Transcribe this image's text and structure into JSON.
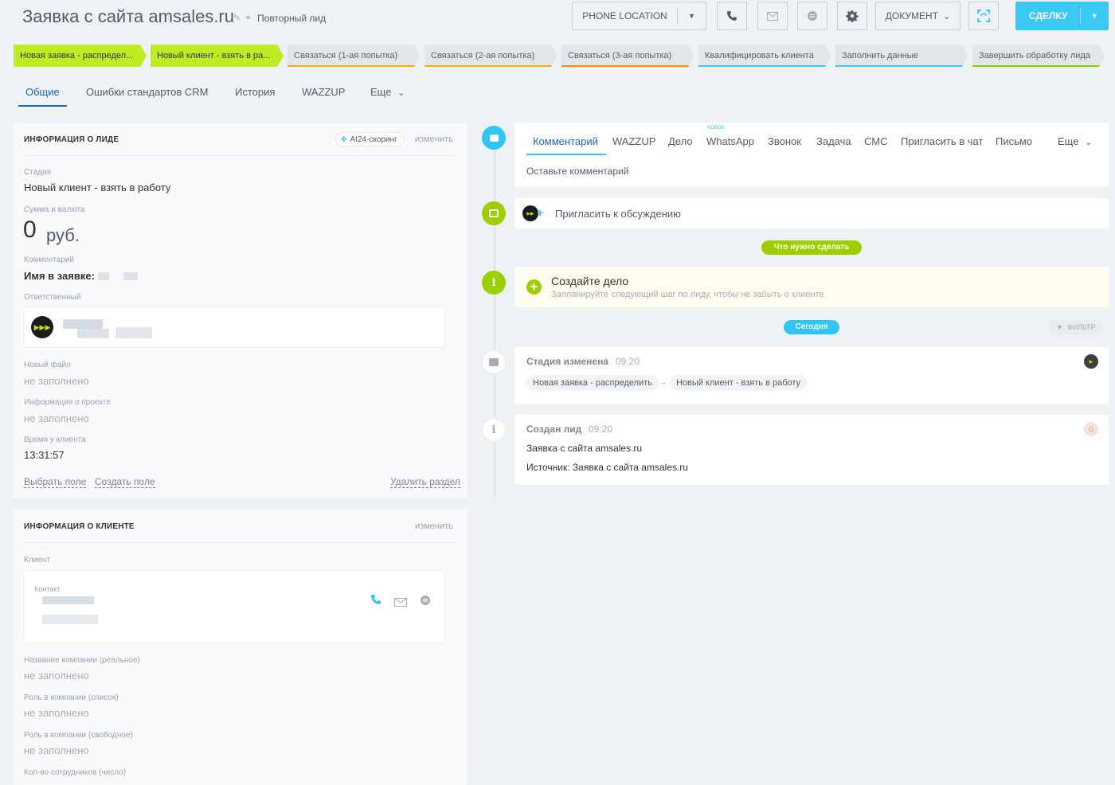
{
  "header": {
    "title": "Заявка с сайта amsales.ru",
    "repeat_label": "Повторный лид",
    "phone_location": "PHONE LOCATION",
    "document": "ДОКУМЕНТ",
    "deal": "СДЕЛКУ"
  },
  "stages": [
    "Новая заявка - распредел...",
    "Новый клиент - взять в ра...",
    "Связаться (1-ая попытка)",
    "Связаться (2-ая попытка)",
    "Связаться (3-ая попытка)",
    "Квалифицировать клиента",
    "Заполнить данные",
    "Завершить обработку лида"
  ],
  "tabs": [
    "Общие",
    "Ошибки стандартов CRM",
    "История",
    "WAZZUP",
    "Еще"
  ],
  "lead_info": {
    "title": "ИНФОРМАЦИЯ О ЛИДЕ",
    "ai_scoring": "AI24-скоринг",
    "edit": "изменить",
    "stage_label": "Стадия",
    "stage_value": "Новый клиент - взять в работу",
    "sum_label": "Сумма и валюта",
    "sum_value": "0",
    "currency": "руб.",
    "comment_label": "Комментарий",
    "comment_value": "Имя в заявке:",
    "responsible_label": "Ответственный",
    "new_file_label": "Новый файл",
    "new_file_value": "не заполнено",
    "project_label": "Информация о проекте",
    "project_value": "не заполнено",
    "client_time_label": "Время у клиента",
    "client_time_value": "13:31:57",
    "choose_field": "Выбрать поле",
    "create_field": "Создать поле",
    "delete_section": "Удалить раздел"
  },
  "client_info": {
    "title": "ИНФОРМАЦИЯ О КЛИЕНТЕ",
    "edit": "изменить",
    "client_label": "Клиент",
    "contact_label": "Контакт",
    "company_label": "Название компании (реальное)",
    "company_value": "не заполнено",
    "role_list_label": "Роль в компании (список)",
    "role_list_value": "не заполнено",
    "role_free_label": "Роль в компании (свободное)",
    "role_free_value": "не заполнено",
    "employees_label": "Кол-во сотрудников (число)"
  },
  "editor": {
    "tabs": [
      "Комментарий",
      "WAZZUP",
      "Дело",
      "WhatsApp",
      "Звонок",
      "Задача",
      "СМС",
      "Пригласить в чат",
      "Письмо",
      "Еще"
    ],
    "new_badge": "НОВОЕ",
    "placeholder": "Оставьте комментарий"
  },
  "timeline": {
    "invite": "Пригласить к обсуждению",
    "todo_pill": "Что нужно сделать",
    "create_task_title": "Создайте дело",
    "create_task_hint": "Запланируйте следующий шаг по лиду, чтобы не забыть о клиенте",
    "today_pill": "Сегодня",
    "filter": "ФИЛЬТР",
    "stage_changed": "Стадия изменена",
    "stage_changed_time": "09:20",
    "stage_from": "Новая заявка - распределить",
    "stage_to": "Новый клиент - взять в работу",
    "lead_created": "Создан лид",
    "lead_created_time": "09:20",
    "lead_created_text": "Заявка с сайта amsales.ru",
    "lead_source": "Источник: Заявка с сайта amsales.ru"
  },
  "colors": {
    "accent_blue": "#2067b0",
    "deal_button": "#3bc8f5",
    "stage_active": "#bbed21",
    "timeline_green": "#9dcf00"
  }
}
